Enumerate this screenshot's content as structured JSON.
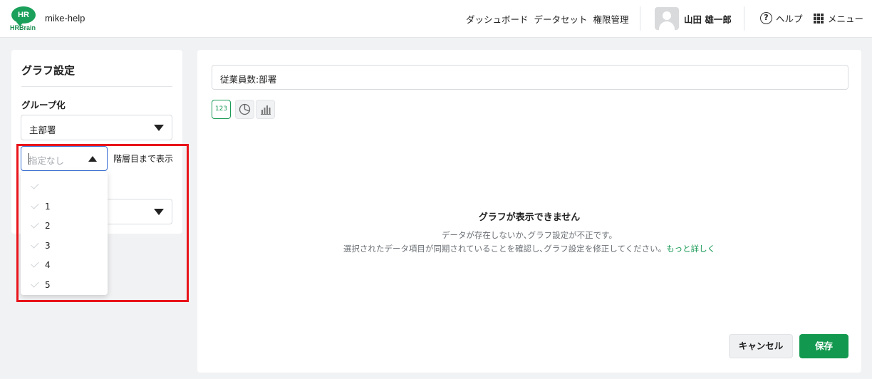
{
  "header": {
    "logo_mark": "HR",
    "logo_text": "HRBrain",
    "app_name": "mike-help",
    "nav": [
      "ダッシュボード",
      "データセット",
      "権限管理"
    ],
    "user_name": "山田 雄一郎",
    "help_label": "ヘルプ",
    "menu_label": "メニュー"
  },
  "graph_settings": {
    "title": "グラフ設定",
    "group_label": "グループ化",
    "group_value": "主部署",
    "level_placeholder": "指定なし",
    "level_suffix": "階層目まで表示",
    "level_options": [
      "",
      "1",
      "2",
      "3",
      "4",
      "5"
    ]
  },
  "main": {
    "title_value": "従業員数:部署",
    "chart_type_number_label": "123",
    "empty_title": "グラフが表示できません",
    "empty_line1": "データが存在しないか､グラフ設定が不正です。",
    "empty_line2": "選択されたデータ項目が同期されていることを確認し､グラフ設定を修正してください。",
    "empty_link": "もっと詳しく",
    "cancel_label": "キャンセル",
    "save_label": "保存"
  },
  "colors": {
    "brand_green": "#13994f",
    "highlight_red": "#e8141a",
    "focus_blue": "#3b6fd6"
  }
}
